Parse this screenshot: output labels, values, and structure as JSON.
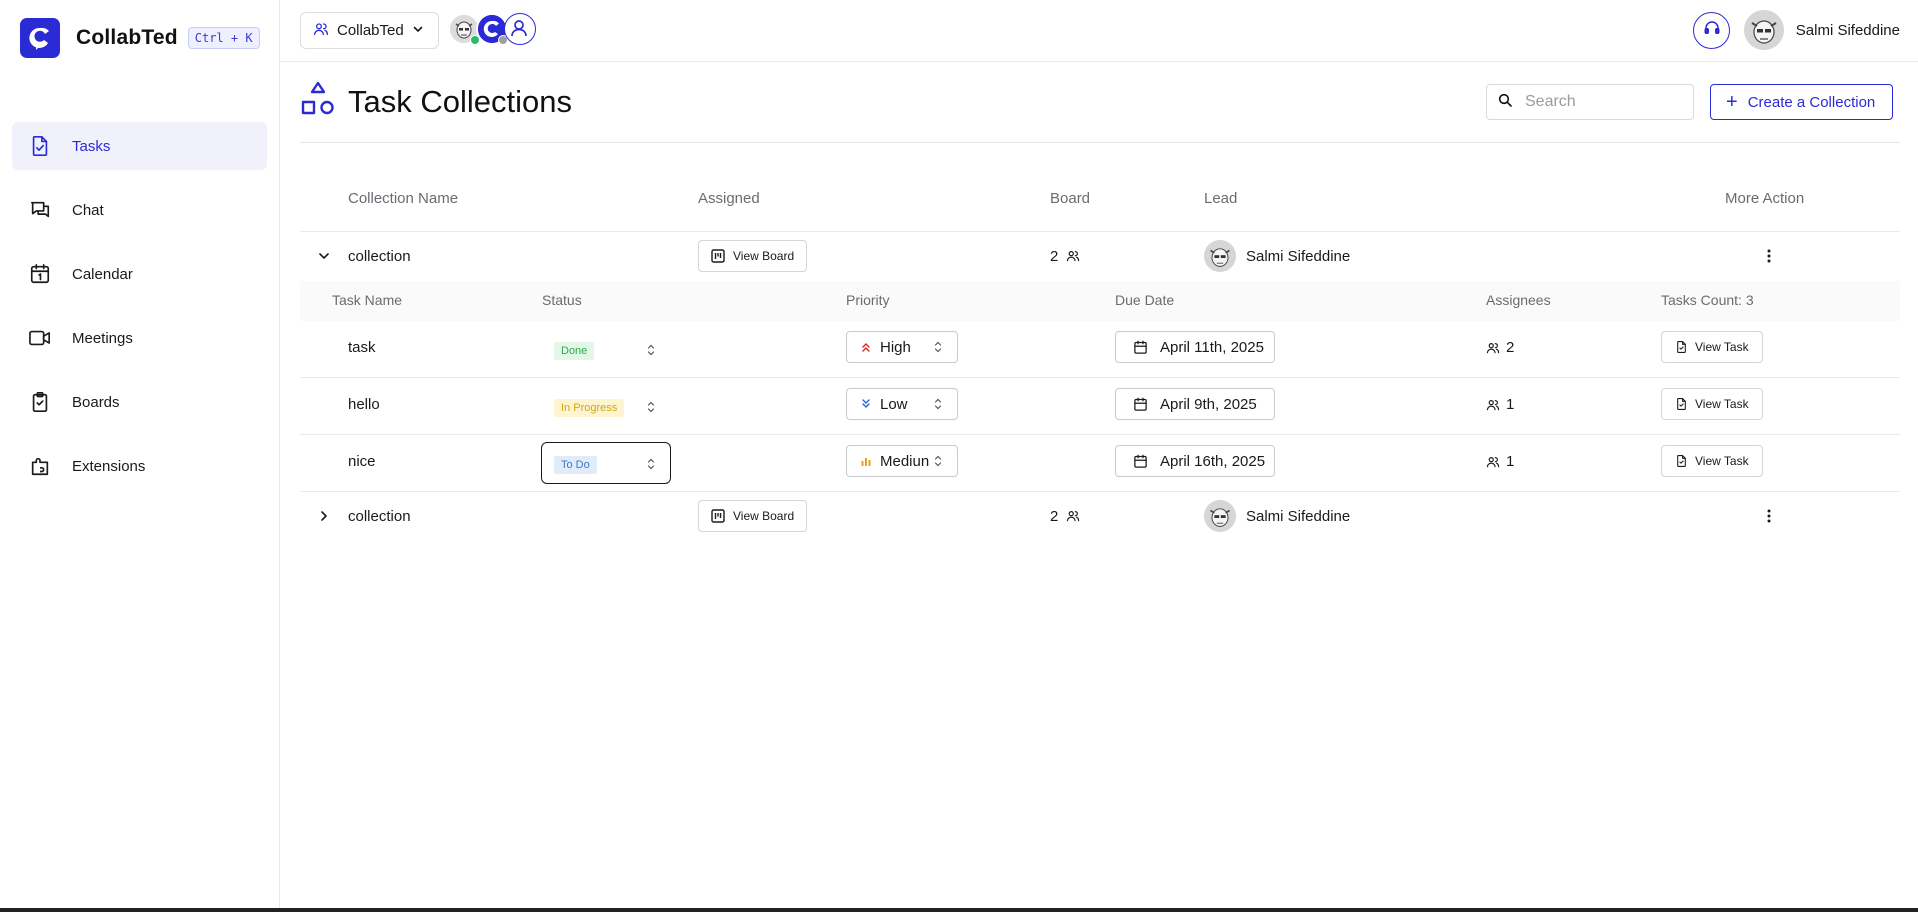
{
  "brand": {
    "name": "CollabTed",
    "shortcut": "Ctrl + K"
  },
  "nav": [
    {
      "label": "Tasks",
      "icon": "tasks-icon",
      "active": true
    },
    {
      "label": "Chat",
      "icon": "chat-icon"
    },
    {
      "label": "Calendar",
      "icon": "calendar-icon"
    },
    {
      "label": "Meetings",
      "icon": "video-icon"
    },
    {
      "label": "Boards",
      "icon": "boards-icon"
    },
    {
      "label": "Extensions",
      "icon": "extensions-icon"
    }
  ],
  "topbar": {
    "workspace": "CollabTed",
    "user_name": "Salmi Sifeddine"
  },
  "page": {
    "title": "Task Collections",
    "search_placeholder": "Search",
    "create_label": "Create a Collection"
  },
  "table": {
    "headers": [
      "Collection Name",
      "Assigned",
      "Board",
      "Lead",
      "More Action"
    ],
    "view_board_label": "View Board",
    "collections": [
      {
        "name": "collection",
        "board_count": "2",
        "lead": "Salmi Sifeddine",
        "expanded": true
      },
      {
        "name": "collection",
        "board_count": "2",
        "lead": "Salmi Sifeddine",
        "expanded": false
      }
    ],
    "subheaders": [
      "Task Name",
      "Status",
      "Priority",
      "Due Date",
      "Assignees",
      "Tasks Count: 3"
    ],
    "view_task_label": "View Task",
    "tasks": [
      {
        "name": "task",
        "status": "Done",
        "priority": "High",
        "due": "April 11th, 2025",
        "assignees": "2"
      },
      {
        "name": "hello",
        "status": "In Progress",
        "priority": "Low",
        "due": "April 9th, 2025",
        "assignees": "1"
      },
      {
        "name": "nice",
        "status": "To Do",
        "priority": "Mediun",
        "due": "April 16th, 2025",
        "assignees": "1"
      }
    ]
  },
  "colors": {
    "accent": "#2b2bd6",
    "done": "#2fa84f",
    "in_progress": "#d4a617",
    "todo": "#3f78c9"
  }
}
